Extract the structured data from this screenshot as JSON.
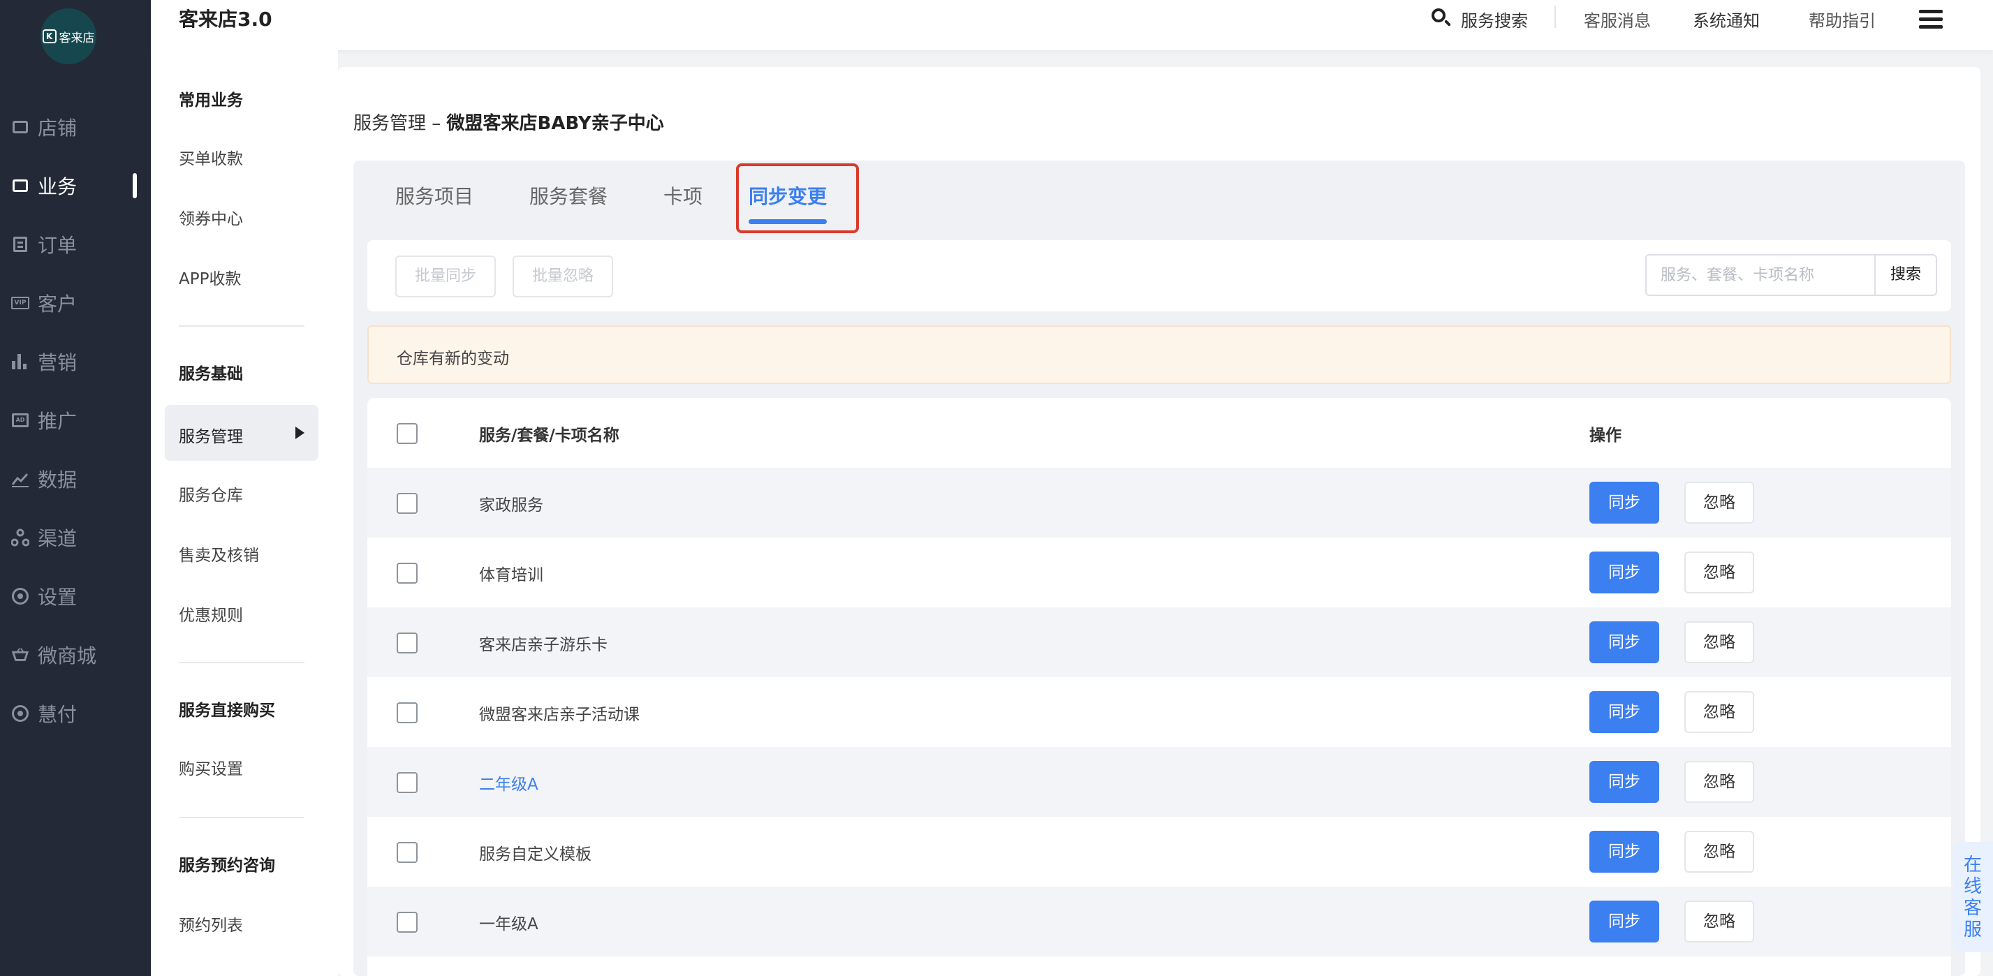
{
  "app": {
    "title": "客来店3.0",
    "logo_text": "客来店",
    "logo_mark": "K"
  },
  "header": {
    "search_label": "服务搜索",
    "links": [
      "客服消息",
      "系统通知",
      "帮助指引"
    ]
  },
  "sidenav": {
    "items": [
      {
        "label": "店铺",
        "icon": "store-icon",
        "active": false
      },
      {
        "label": "业务",
        "icon": "briefcase-icon",
        "active": true
      },
      {
        "label": "订单",
        "icon": "order-list-icon",
        "active": false
      },
      {
        "label": "客户",
        "icon": "vip-card-icon",
        "active": false
      },
      {
        "label": "营销",
        "icon": "bar-chart-icon",
        "active": false
      },
      {
        "label": "推广",
        "icon": "ad-icon",
        "active": false
      },
      {
        "label": "数据",
        "icon": "line-chart-icon",
        "active": false
      },
      {
        "label": "渠道",
        "icon": "channel-icon",
        "active": false
      },
      {
        "label": "设置",
        "icon": "gear-icon",
        "active": false
      },
      {
        "label": "微商城",
        "icon": "basket-icon",
        "active": false
      },
      {
        "label": "慧付",
        "icon": "pay-icon",
        "active": false
      }
    ],
    "vip_text": "VIP",
    "ad_text": "AD"
  },
  "subnav": {
    "groups": [
      {
        "heading": "常用业务",
        "items": [
          "买单收款",
          "领券中心",
          "APP收款"
        ]
      },
      {
        "heading": "服务基础",
        "items": [
          "服务管理",
          "服务仓库",
          "售卖及核销",
          "优惠规则"
        ],
        "active": "服务管理"
      },
      {
        "heading": "服务直接购买",
        "items": [
          "购买设置"
        ]
      },
      {
        "heading": "服务预约咨询",
        "items": [
          "预约列表"
        ]
      }
    ]
  },
  "page": {
    "title_prefix": "服务管理 – ",
    "title_store": "微盟客来店BABY亲子中心",
    "tabs": [
      "服务项目",
      "服务套餐",
      "卡项",
      "同步变更"
    ],
    "active_tab": "同步变更",
    "batch_sync": "批量同步",
    "batch_ignore": "批量忽略",
    "search_placeholder": "服务、套餐、卡项名称",
    "search_button": "搜索",
    "notice": "仓库有新的变动"
  },
  "table": {
    "columns": [
      "服务/套餐/卡项名称",
      "操作"
    ],
    "sync_label": "同步",
    "ignore_label": "忽略",
    "rows": [
      {
        "name": "家政服务",
        "link": false
      },
      {
        "name": "体育培训",
        "link": false
      },
      {
        "name": "客来店亲子游乐卡",
        "link": false
      },
      {
        "name": "微盟客来店亲子活动课",
        "link": false
      },
      {
        "name": "二年级A",
        "link": true
      },
      {
        "name": "服务自定义模板",
        "link": false
      },
      {
        "name": "一年级A",
        "link": false
      }
    ]
  },
  "float_service": "在线客服",
  "colors": {
    "accent": "#3b7ff0",
    "sidebar_bg": "#232936",
    "highlight_border": "#d93a2b",
    "notice_bg": "#fdf4ea"
  }
}
